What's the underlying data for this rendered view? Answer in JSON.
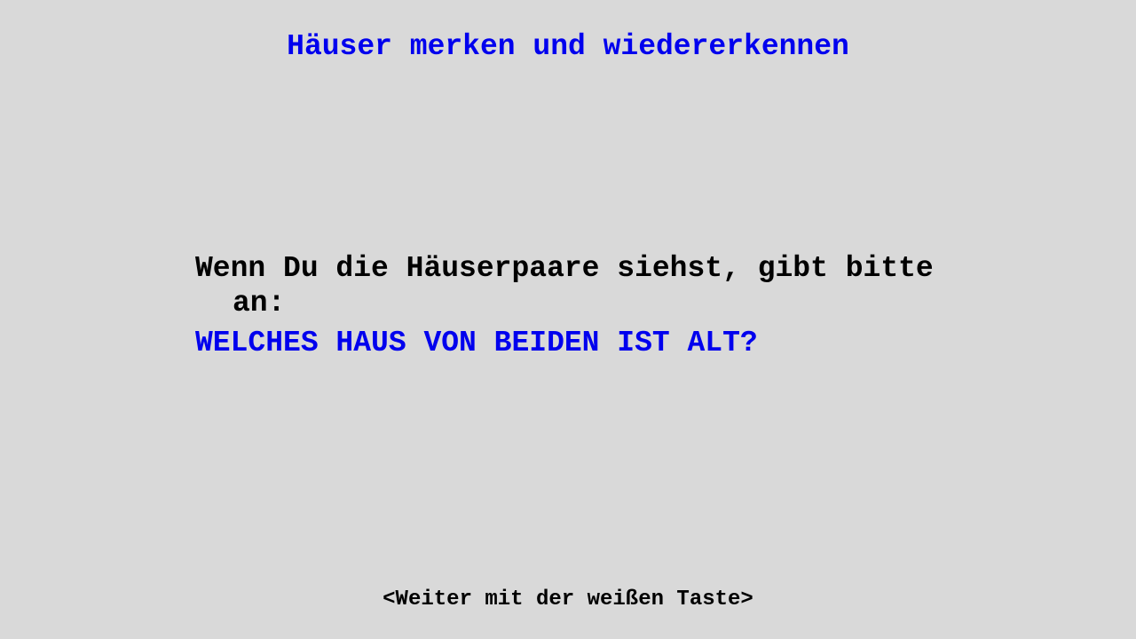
{
  "screen": {
    "title": "Häuser merken und wiedererkennen",
    "instruction": "Wenn Du die Häuserpaare siehst, gibt bitte an:",
    "question": "WELCHES HAUS VON BEIDEN IST ALT?",
    "continue_hint": "<Weiter mit der weißen Taste>"
  },
  "colors": {
    "background": "#d9d9d9",
    "accent": "#0000ee",
    "text": "#000000"
  }
}
